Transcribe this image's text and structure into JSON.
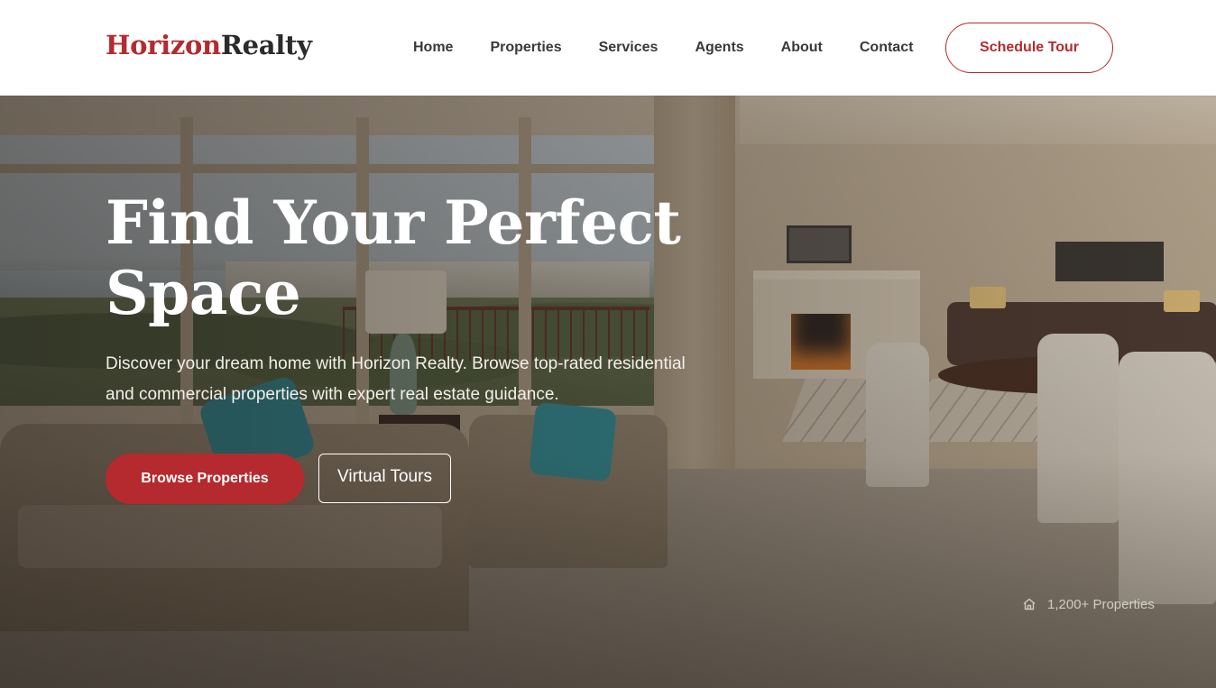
{
  "brand": {
    "part1": "Horizon",
    "part2": "Realty",
    "accent_color": "#b52a2e"
  },
  "nav": {
    "items": [
      {
        "label": "Home"
      },
      {
        "label": "Properties"
      },
      {
        "label": "Services"
      },
      {
        "label": "Agents"
      },
      {
        "label": "About"
      },
      {
        "label": "Contact"
      }
    ],
    "cta_label": "Schedule Tour"
  },
  "hero": {
    "title": "Find Your Perfect Space",
    "subtitle": "Discover your dream home with Horizon Realty. Browse top-rated residential and commercial properties with expert real estate guidance.",
    "primary_button": "Browse Properties",
    "secondary_button": "Virtual Tours",
    "stat": {
      "icon": "home-icon",
      "label": "1,200+ Properties"
    }
  }
}
